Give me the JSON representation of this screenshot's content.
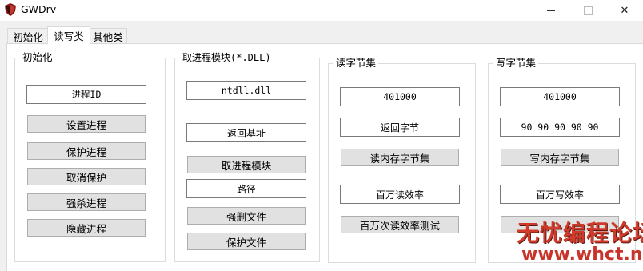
{
  "window": {
    "title": "GWDrv",
    "close_glyph": "✕"
  },
  "tabs": [
    {
      "label": "初始化"
    },
    {
      "label": "读写类"
    },
    {
      "label": "其他类"
    }
  ],
  "groups": {
    "init": {
      "title": "初始化",
      "pid_field": "进程ID",
      "buttons": [
        "设置进程",
        "保护进程",
        "取消保护",
        "强杀进程",
        "隐藏进程"
      ]
    },
    "module": {
      "title": "取进程模块(*.DLL)",
      "module_field": "ntdll.dll",
      "base_field": "返回基址",
      "get_module_button": "取进程模块",
      "path_field": "路径",
      "force_delete_button": "强删文件",
      "protect_file_button": "保护文件"
    },
    "read": {
      "title": "读字节集",
      "address_field": "401000",
      "result_field": "返回字节",
      "read_button": "读内存字节集",
      "efficiency_field": "百万读效率",
      "test_button": "百万次读效率测试"
    },
    "write": {
      "title": "写字节集",
      "address_field": "401000",
      "bytes_field": "90 90 90 90 90",
      "write_button": "写内存字节集",
      "efficiency_field": "百万写效率"
    }
  },
  "watermark": {
    "line1": "无忧编程论坛",
    "line2": "www.whct.net"
  },
  "colors": {
    "icon_red": "#8b1a1a",
    "watermark": "#d13a2a"
  }
}
